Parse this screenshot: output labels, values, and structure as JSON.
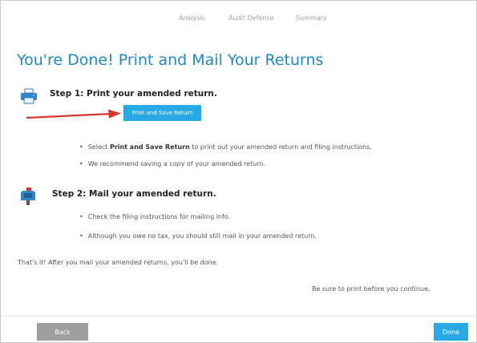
{
  "nav": {
    "items": [
      "Analysis",
      "Audit Defense",
      "Summary"
    ]
  },
  "page": {
    "title": "You're Done! Print and Mail Your Returns"
  },
  "step1": {
    "title": "Step 1: Print your amended return.",
    "icon": "printer-icon",
    "button_label": "Print and Save Return",
    "bullets": [
      {
        "pre": "Select ",
        "bold": "Print and Save Return",
        "post": " to print out your amended return and filing instructions."
      },
      {
        "pre": "We recommend saving a copy of your amended return.",
        "bold": "",
        "post": ""
      }
    ]
  },
  "step2": {
    "title": "Step 2: Mail your amended return.",
    "icon": "mailbox-icon",
    "bullets": [
      "Check the filing instructions for mailing info.",
      "Although you owe no tax, you should still mail in your amended return."
    ]
  },
  "closing_text": "That's it! After you mail your amended returns, you'll be done.",
  "reminder_text": "Be sure to print before you continue.",
  "footer": {
    "back_label": "Back",
    "done_label": "Done"
  },
  "colors": {
    "accent": "#29a8e6",
    "title": "#1e88c8",
    "arrow": "#d9362b",
    "back_button": "#9e9e9e"
  }
}
